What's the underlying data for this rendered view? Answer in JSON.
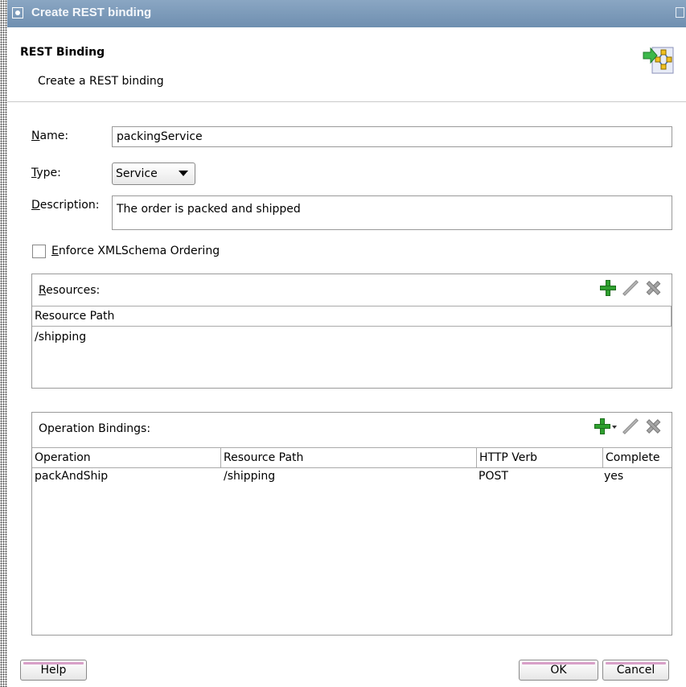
{
  "window": {
    "title": "Create REST binding"
  },
  "header": {
    "title": "REST Binding",
    "subtitle": "Create a REST binding",
    "icon": "wizard-rest-icon"
  },
  "form": {
    "name_label": "Name:",
    "name_value": "packingService",
    "type_label": "Type:",
    "type_value": "Service",
    "description_label": "Description:",
    "description_value": "The order is packed and shipped",
    "enforce_label": "Enforce XMLSchema Ordering",
    "enforce_checked": false
  },
  "resources": {
    "label": "Resources:",
    "columns": [
      "Resource Path"
    ],
    "rows": [
      [
        "/shipping"
      ]
    ]
  },
  "operation_bindings": {
    "label": "Operation Bindings:",
    "columns": [
      "Operation",
      "Resource Path",
      "HTTP Verb",
      "Complete"
    ],
    "rows": [
      [
        "packAndShip",
        "/shipping",
        "POST",
        "yes"
      ]
    ]
  },
  "buttons": {
    "help": "Help",
    "ok": "OK",
    "cancel": "Cancel"
  },
  "colors": {
    "titlebar": "#7f9db9",
    "add_icon": "#2ea02e",
    "button_accent": "#d8a0c8"
  }
}
